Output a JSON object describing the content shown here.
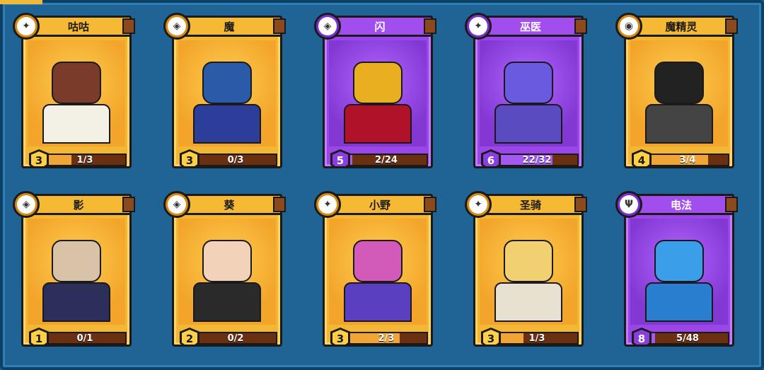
{
  "cards": [
    {
      "name": "咕咕",
      "rarity": "gold",
      "class_icon": "sparkle-icon",
      "level": "3",
      "progress": "1/3",
      "fill": 0.33,
      "colors": {
        "head": "#7a3b2b",
        "torso": "#f3f0e6"
      }
    },
    {
      "name": "魔",
      "rarity": "gold",
      "class_icon": "target-diamond-icon",
      "level": "3",
      "progress": "0/3",
      "fill": 0.0,
      "colors": {
        "head": "#2a5aa8",
        "torso": "#2c3e9a"
      }
    },
    {
      "name": "闪",
      "rarity": "purple",
      "class_icon": "target-diamond-icon",
      "level": "5",
      "progress": "2/24",
      "fill": 0.08,
      "colors": {
        "head": "#e8b020",
        "torso": "#b0122a"
      }
    },
    {
      "name": "巫医",
      "rarity": "purple",
      "class_icon": "sparkle-icon",
      "level": "6",
      "progress": "22/32",
      "fill": 0.69,
      "colors": {
        "head": "#6a5ae0",
        "torso": "#5a4cc0"
      }
    },
    {
      "name": "魔精灵",
      "rarity": "gold",
      "class_icon": "pokeball-icon",
      "level": "4",
      "progress": "3/4",
      "fill": 0.75,
      "colors": {
        "head": "#222222",
        "torso": "#444444"
      }
    },
    {
      "name": "影",
      "rarity": "gold",
      "class_icon": "target-diamond-icon",
      "level": "1",
      "progress": "0/1",
      "fill": 0.0,
      "colors": {
        "head": "#d9c3a8",
        "torso": "#2b2f5a"
      }
    },
    {
      "name": "葵",
      "rarity": "gold",
      "class_icon": "target-diamond-icon",
      "level": "2",
      "progress": "0/2",
      "fill": 0.0,
      "colors": {
        "head": "#f2d2b8",
        "torso": "#2a2a2a"
      }
    },
    {
      "name": "小野",
      "rarity": "gold",
      "class_icon": "sparkle-icon",
      "level": "3",
      "progress": "2/3",
      "fill": 0.67,
      "colors": {
        "head": "#d25ab8",
        "torso": "#5a3fc0"
      }
    },
    {
      "name": "圣骑",
      "rarity": "gold",
      "class_icon": "sparkle-icon",
      "level": "3",
      "progress": "1/3",
      "fill": 0.33,
      "colors": {
        "head": "#f0d070",
        "torso": "#e8e0d0"
      }
    },
    {
      "name": "电法",
      "rarity": "purple",
      "class_icon": "lightning-fork-icon",
      "level": "8",
      "progress": "5/48",
      "fill": 0.1,
      "colors": {
        "head": "#3a9ee8",
        "torso": "#2a7ed0"
      }
    }
  ]
}
